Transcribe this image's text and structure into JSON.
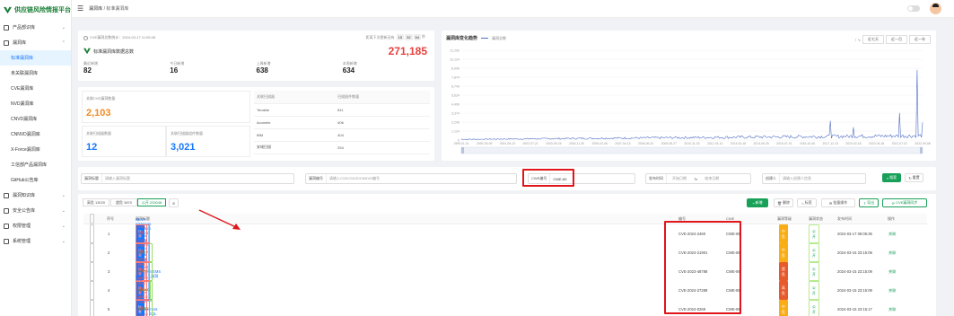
{
  "app": {
    "title": "供应链风险情报平台"
  },
  "sidebar": {
    "items": [
      {
        "label": "产品部识库",
        "children": []
      },
      {
        "label": "漏洞库",
        "children": [
          "标准漏洞库",
          "未关联漏洞库",
          "CVE漏洞库",
          "NVD漏洞库",
          "CNVD漏洞库",
          "CNNVD漏洞库",
          "X-Force漏洞库",
          "工信部产品漏洞库",
          "GitHub公告库"
        ],
        "active_child": 0
      },
      {
        "label": "漏洞知识库",
        "children": []
      },
      {
        "label": "安全公告库",
        "children": []
      },
      {
        "label": "权限管理",
        "children": []
      },
      {
        "label": "系统管理",
        "children": []
      }
    ]
  },
  "topbar": {
    "breadcrumb_root": "漏洞库",
    "breadcrumb_sep": "/",
    "breadcrumb_current": "标准漏洞库"
  },
  "summary": {
    "update_text": "CVE漏洞总数统计：2024-03-17 11:05:08",
    "next_update_label": "距离下次更新还有",
    "countdown": [
      "15",
      "32",
      "54",
      "秒"
    ],
    "title": "标准漏洞库数据总数",
    "total": "271,185",
    "stats": [
      {
        "label": "最近新增",
        "value": "82"
      },
      {
        "label": "今日新增",
        "value": "16"
      },
      {
        "label": "上周新增",
        "value": "638"
      },
      {
        "label": "本周新增",
        "value": "634"
      }
    ]
  },
  "counts": {
    "left": [
      {
        "label": "关联CVE漏洞数量",
        "value": "2,103",
        "color": "#f08a24"
      },
      {
        "label": "关联扫描器数量",
        "value": "12",
        "color": "#1677ff"
      },
      {
        "label": "关联扫描器组件数量",
        "value": "3,021",
        "color": "#1677ff"
      }
    ],
    "table_headers": [
      "关联扫描器",
      "扫描插件数量"
    ],
    "table_rows": [
      [
        "Tenable",
        "811"
      ],
      [
        "Acunetix",
        "406"
      ],
      [
        "IBM",
        "404"
      ],
      [
        "安域扫描",
        "254"
      ]
    ]
  },
  "chart_panel": {
    "title": "漏洞库变化趋势",
    "legend": "漏洞总数",
    "range_buttons": [
      "近七天",
      "近一月",
      "近一年"
    ]
  },
  "chart_data": {
    "type": "line",
    "series": [
      {
        "name": "漏洞总数"
      }
    ],
    "y_ticks": [
      "11,250",
      "10,124",
      "8,999",
      "7,874",
      "6,749",
      "5,624",
      "4,499",
      "3,374",
      "2,249",
      "1,124",
      "0"
    ],
    "ylim": [
      0,
      11250
    ],
    "x_ticks": [
      "1999-01-01",
      "2000-03-09",
      "2001-05-13",
      "2002-07-21",
      "2003-09-25",
      "2004-11-30",
      "2006-02-06",
      "2007-04-13",
      "2008-06-20",
      "2009-08-27",
      "2010-11-03",
      "2012-01-10",
      "2013-03-18",
      "2014-05-25",
      "2015-07-31",
      "2016-10-06",
      "2017-12-13",
      "2019-02-18",
      "2020-04-26",
      "2021-07-02",
      "2022-09-08"
    ],
    "spikes": [
      {
        "x": "2017-12-13",
        "value": 2400
      },
      {
        "x": "2019-02-18",
        "value": 1600
      },
      {
        "x": "2021-07-02",
        "value": 3400
      },
      {
        "x": "2022-05-18",
        "value": 8800
      },
      {
        "x": "2022-09-08",
        "value": 2200
      }
    ],
    "baseline": 300
  },
  "filters": {
    "search_title_label": "漏洞标题",
    "search_title_placeholder": "请输入漏洞标题",
    "vuln_no_label": "漏洞编号",
    "vuln_no_placeholder": "请输入CVE/CNVD/CNNVD编号",
    "cwe_label": "CWE编号",
    "cwe_value": "CWE-89",
    "date_label": "发布时间",
    "date_start": "开始日期",
    "date_to": "To",
    "date_end": "结束日期",
    "creator_label": "创建人",
    "creator_placeholder": "请输入创建人信息",
    "search_btn": "搜索",
    "reset_btn": "重置"
  },
  "tabs": [
    "高危 13020",
    "超危 3870",
    "公开 203048"
  ],
  "actions": [
    "新增",
    "删除",
    "标签",
    "批量操作",
    "导出",
    "CVE漏洞同步"
  ],
  "grid": {
    "headers": [
      "序号",
      "漏洞标题",
      "编号",
      "CWE",
      "漏洞等级",
      "漏洞状态",
      "发布时间",
      "操作"
    ],
    "rows": [
      {
        "no": "1",
        "title": "NEVA Sistemas ePMWeb Execute Page SQL注入漏洞",
        "tags": [
          "CVE",
          "X-Force"
        ],
        "labels": [
          "SQL",
          "CWE Top 25 (2023)"
        ],
        "id": "CVE-2024-2460",
        "cwe": "CWE-89",
        "level": "中危",
        "level_type": "mid",
        "status": "公开",
        "time": "2024-03-17 06:05:36",
        "op": "关联"
      },
      {
        "no": "2",
        "title": "SNAP Systems跨防产品SQL注入漏洞",
        "tags": [
          "CVE",
          "CNNVD",
          "X-Force"
        ],
        "labels": [
          "SQL",
          "CWE Top 25 (2023)"
        ],
        "id": "CVE-2024-21901",
        "cwe": "CWE-89",
        "level": "中危",
        "level_type": "mid",
        "status": "公开",
        "time": "2024-03-15 23:15:09",
        "op": "关联"
      },
      {
        "no": "3",
        "title": "Fortinet FortiClientEMS SQL注入漏洞",
        "tags": [
          "CVE",
          "X-Force",
          "CNNVD"
        ],
        "labels": [
          "SQL",
          "无需认证",
          "CWE Top 25 (2023)"
        ],
        "id": "CVE-2023-48788",
        "cwe": "CWE-89",
        "level": "超危",
        "level_type": "high",
        "status": "公开",
        "time": "2024-03-15 23:15:09",
        "op": "关联"
      },
      {
        "no": "4",
        "title": "pgx SQL注入漏洞 CVE-2024-27289",
        "tags": [
          "GitHub",
          "X-Force",
          "CNNVD"
        ],
        "labels": [
          "SQL",
          "无需认证",
          "CWE Top 25 (2023)",
          "…"
        ],
        "id": "CVE-2024-27289",
        "cwe": "CWE-89",
        "level": "高危",
        "level_type": "high",
        "status": "公开",
        "time": "2024-03-15 23:15:09",
        "op": "关联"
      },
      {
        "no": "5",
        "title": "Kashipara Food Management System SQL注入漏洞",
        "tags": [
          "CVE",
          "CNNVD",
          "CNVD"
        ],
        "labels": [
          "SQL",
          "CWE Top 25 (2023)"
        ],
        "id": "CVE-2024-0269",
        "cwe": "CWE-89",
        "level": "中危",
        "level_type": "mid",
        "status": "公开",
        "time": "2024-03-15 23:15:17",
        "op": "关联"
      }
    ]
  },
  "colors": {
    "accent": "#18a058",
    "highlight": "#e0161a",
    "link": "#1677ff",
    "total": "#e8413c"
  }
}
